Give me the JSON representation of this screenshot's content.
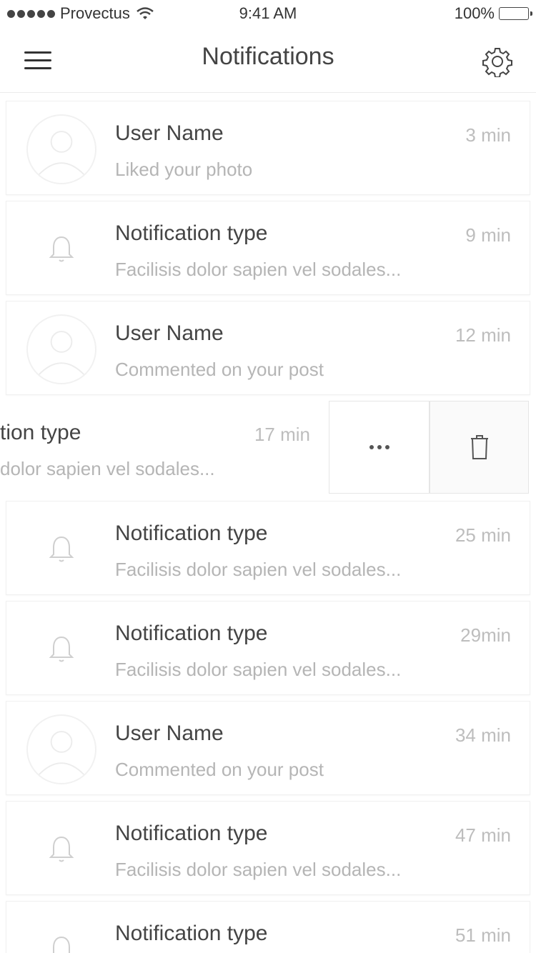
{
  "status_bar": {
    "carrier": "Provectus",
    "time": "9:41 AM",
    "battery": "100%"
  },
  "navbar": {
    "title": "Notifications",
    "icons": {
      "menu": "hamburger-menu-icon",
      "settings": "gear-icon"
    }
  },
  "colors": {
    "title_text": "#444444",
    "subtitle_text": "#b5b5b5",
    "time_text": "#bdbdbd",
    "card_border": "#f0f0f0",
    "icon_stroke": "#d6d6d6"
  },
  "notifications": [
    {
      "kind": "user",
      "title": "User Name",
      "subtitle": "Liked your photo",
      "time": "3 min"
    },
    {
      "kind": "system",
      "title": "Notification type",
      "subtitle": "Facilisis dolor sapien vel sodales...",
      "time": "9 min"
    },
    {
      "kind": "user",
      "title": "User Name",
      "subtitle": "Commented on your post",
      "time": "12 min"
    },
    {
      "kind": "system",
      "title": "tion type",
      "subtitle": "dolor sapien vel sodales...",
      "time": "17 min",
      "swiped": true
    },
    {
      "kind": "system",
      "title": "Notification type",
      "subtitle": "Facilisis dolor sapien vel sodales...",
      "time": "25 min"
    },
    {
      "kind": "system",
      "title": "Notification type",
      "subtitle": "Facilisis dolor sapien vel sodales...",
      "time": "29min"
    },
    {
      "kind": "user",
      "title": "User Name",
      "subtitle": "Commented on your post",
      "time": "34 min"
    },
    {
      "kind": "system",
      "title": "Notification type",
      "subtitle": "Facilisis dolor sapien vel sodales...",
      "time": "47 min"
    },
    {
      "kind": "system",
      "title": "Notification type",
      "subtitle": "",
      "time": "51 min"
    }
  ],
  "swipe_actions": {
    "more_icon": "more-dots-icon",
    "delete_icon": "trash-icon"
  }
}
